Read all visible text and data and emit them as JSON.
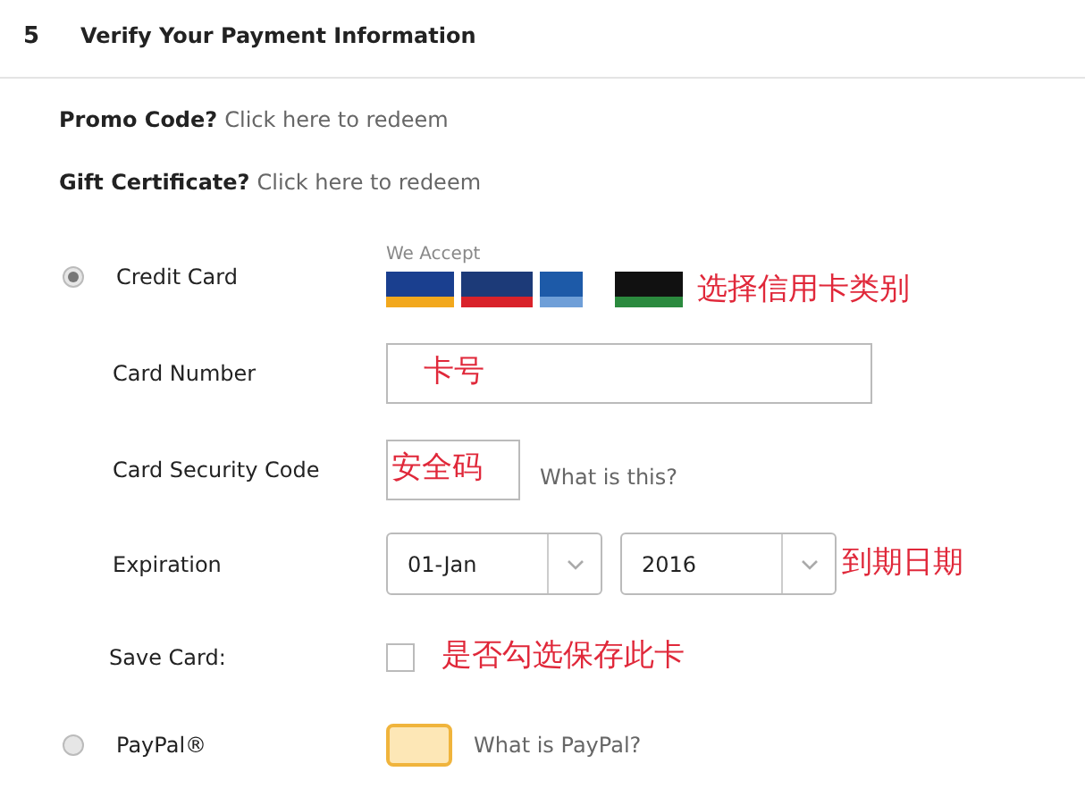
{
  "step": {
    "number": "5",
    "title": "Verify Your Payment Information"
  },
  "promo": {
    "label": "Promo Code?",
    "link": "Click here to redeem"
  },
  "gift": {
    "label": "Gift Certificate?",
    "link": "Click here to redeem"
  },
  "methods": [
    {
      "kind": "card",
      "label": "Credit Card",
      "selected": true,
      "accept_label": "We Accept",
      "note": "选择信用卡类别",
      "fields": [
        {
          "kind": "text",
          "label": "Card Number",
          "value": "卡号"
        },
        {
          "kind": "cvv",
          "label": "Card Security Code",
          "value": "安全码",
          "help": "What is this?"
        },
        {
          "kind": "expiry",
          "label": "Expiration",
          "selects": [
            "01-Jan",
            "2016"
          ],
          "note": "到期日期"
        },
        {
          "kind": "checkbox",
          "label": "Save Card:",
          "checked": false,
          "note": "是否勾选保存此卡"
        }
      ]
    },
    {
      "kind": "paypal",
      "label": "PayPal®",
      "selected": false,
      "help": "What is PayPal?"
    }
  ]
}
